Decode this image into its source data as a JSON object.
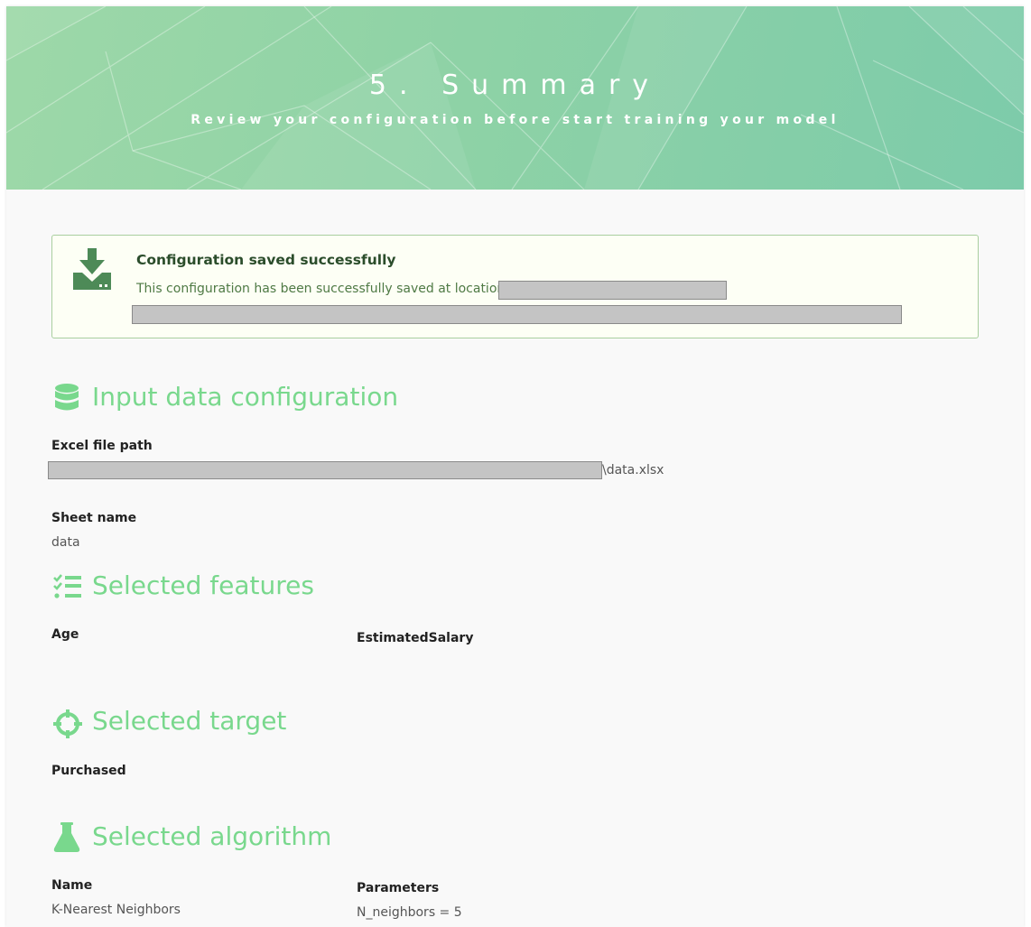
{
  "header": {
    "title": "5. Summary",
    "subtitle": "Review your configuration before start training your model"
  },
  "alert": {
    "icon": "download-icon",
    "title": "Configuration saved successfully",
    "message": "This configuration has been successfully saved at location"
  },
  "input_data": {
    "icon": "database-icon",
    "title": "Input data configuration",
    "excel_label": "Excel file path",
    "excel_suffix": "\\data.xlsx",
    "sheet_label": "Sheet name",
    "sheet_value": "data"
  },
  "features": {
    "icon": "checklist-icon",
    "title": "Selected features",
    "items": [
      "Age",
      "EstimatedSalary"
    ]
  },
  "target": {
    "icon": "crosshair-icon",
    "title": "Selected target",
    "value": "Purchased"
  },
  "algorithm": {
    "icon": "flask-icon",
    "title": "Selected algorithm",
    "name_label": "Name",
    "name_value": "K-Nearest Neighbors",
    "params_label": "Parameters",
    "params_value": "N_neighbors = 5"
  },
  "colors": {
    "accent": "#79d88d",
    "alert_border": "#a9cf9f",
    "alert_icon": "#4d8a57"
  }
}
